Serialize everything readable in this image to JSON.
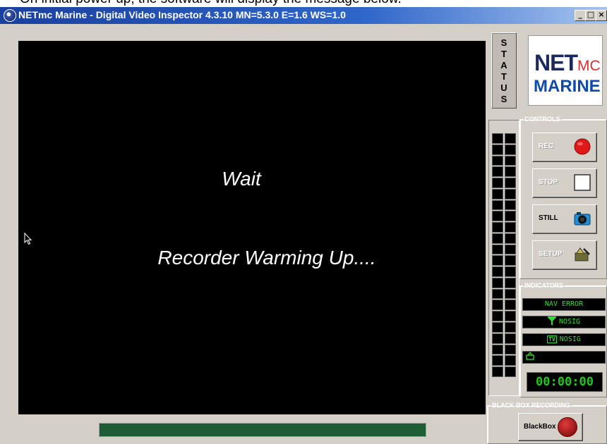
{
  "caption": "On initial power up, the software will display the message below.",
  "window": {
    "title": "NETmc Marine - Digital Video Inspector 4.3.10 MN=5.3.0 E=1.6 WS=1.0",
    "minimize_glyph": "_",
    "maximize_glyph": "□",
    "close_glyph": "×"
  },
  "video": {
    "line1": "Wait",
    "line2": "Recorder Warming Up...."
  },
  "progress": {
    "value": 1.0,
    "color": "#1e5e36"
  },
  "status_panel": {
    "letters": [
      "S",
      "T",
      "A",
      "T",
      "U",
      "S"
    ]
  },
  "logo": {
    "net": "NET",
    "mc": "MC",
    "marine": "MARINE"
  },
  "controls": {
    "legend": "CONTROLS",
    "rec_label": "REC",
    "stop_label": "STOP",
    "still_label": "STILL",
    "setup_label": "SETUP"
  },
  "indicators": {
    "legend": "INDICATORS",
    "nav_error": "NAV ERROR",
    "gps_icon": "antenna-icon",
    "gps_status": "NOSIG",
    "tv_icon": "tv-icon",
    "tv_glyph": "TV",
    "tv_status": "NOSIG",
    "disk_icon": "recorder-icon",
    "timer": "00:00:00"
  },
  "blackbox": {
    "legend": "BLACK BOX RECORDING",
    "button_label": "BlackBox"
  },
  "colors": {
    "titlebar": "#2f66c9",
    "panel": "#d4d0c8",
    "indicator_green": "#2de02d"
  }
}
